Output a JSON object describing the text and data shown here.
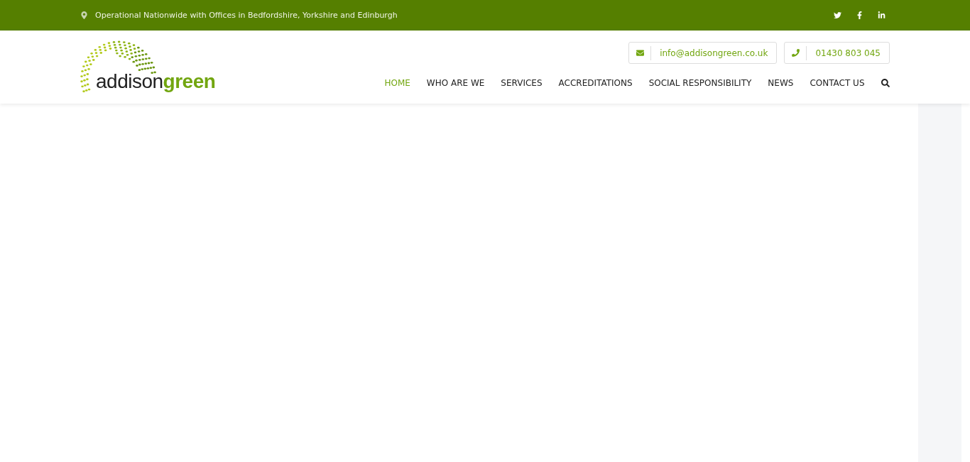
{
  "top_bar": {
    "location": "Operational Nationwide with Offices in Bedfordshire, Yorkshire and Edinburgh",
    "social": [
      {
        "kind": "twitter"
      },
      {
        "kind": "facebook"
      },
      {
        "kind": "linkedin"
      }
    ]
  },
  "logo": {
    "part_1": "addison",
    "part_2": "green"
  },
  "contacts": [
    {
      "kind": "email",
      "text": "info@addisongreen.co.uk"
    },
    {
      "kind": "phone",
      "text": "01430 803 045"
    }
  ],
  "nav": [
    {
      "label": "HOME",
      "selected": true
    },
    {
      "label": "WHO ARE WE",
      "selected": false
    },
    {
      "label": "SERVICES",
      "selected": false
    },
    {
      "label": "ACCREDITATIONS",
      "selected": false
    },
    {
      "label": "SOCIAL RESPONSIBILITY",
      "selected": false
    },
    {
      "label": "NEWS",
      "selected": false
    },
    {
      "label": "CONTACT US",
      "selected": false
    }
  ]
}
